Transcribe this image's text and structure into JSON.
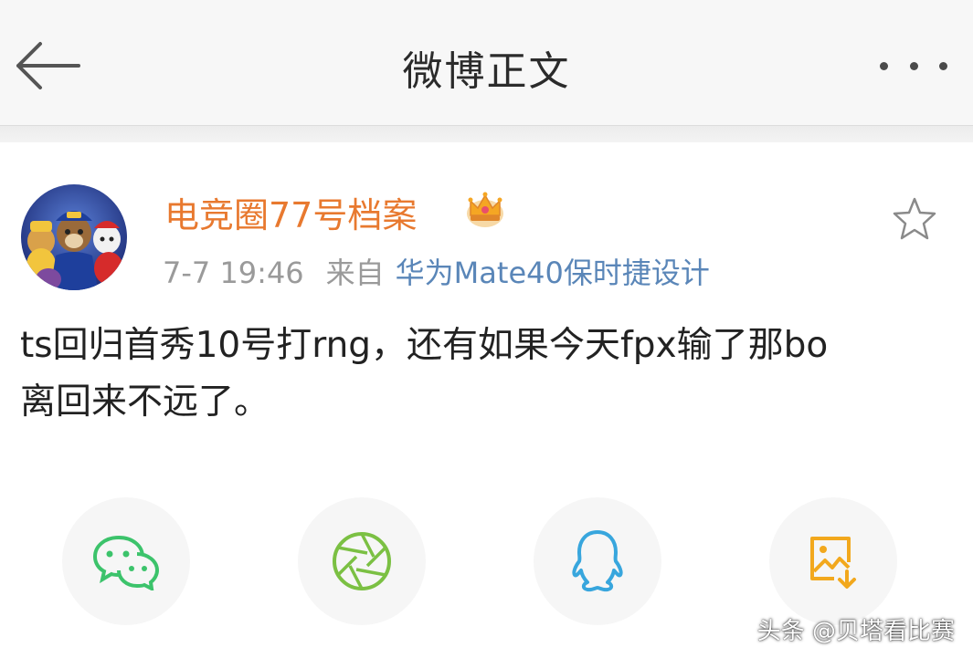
{
  "header": {
    "title": "微博正文",
    "back_icon": "arrow-left-icon",
    "more_icon": "more-horizontal-icon"
  },
  "post": {
    "author": "电竞圈77号档案",
    "avatar_icon": "avatar-cartoon-dogs",
    "badge_icon": "vip-crown-icon",
    "time": "7-7 19:46",
    "from_label": "来自",
    "device": "华为Mate40保时捷设计",
    "content_line1": "ts回归首秀10号打rng，还有如果今天fpx输了那bo",
    "content_line2": "离回来不远了。",
    "favorite_icon": "star-outline-icon"
  },
  "share": [
    {
      "name": "wechat",
      "icon": "wechat-icon"
    },
    {
      "name": "moments",
      "icon": "moments-aperture-icon"
    },
    {
      "name": "qq",
      "icon": "qq-penguin-icon"
    },
    {
      "name": "save-image",
      "icon": "save-image-icon"
    }
  ],
  "watermark": "头条 @贝塔看比赛",
  "colors": {
    "author": "#e8792f",
    "device_link": "#5a86b8",
    "wechat": "#3cc36b",
    "moments": "#7bc043",
    "qq": "#38a6dd",
    "save": "#f2a81d"
  }
}
